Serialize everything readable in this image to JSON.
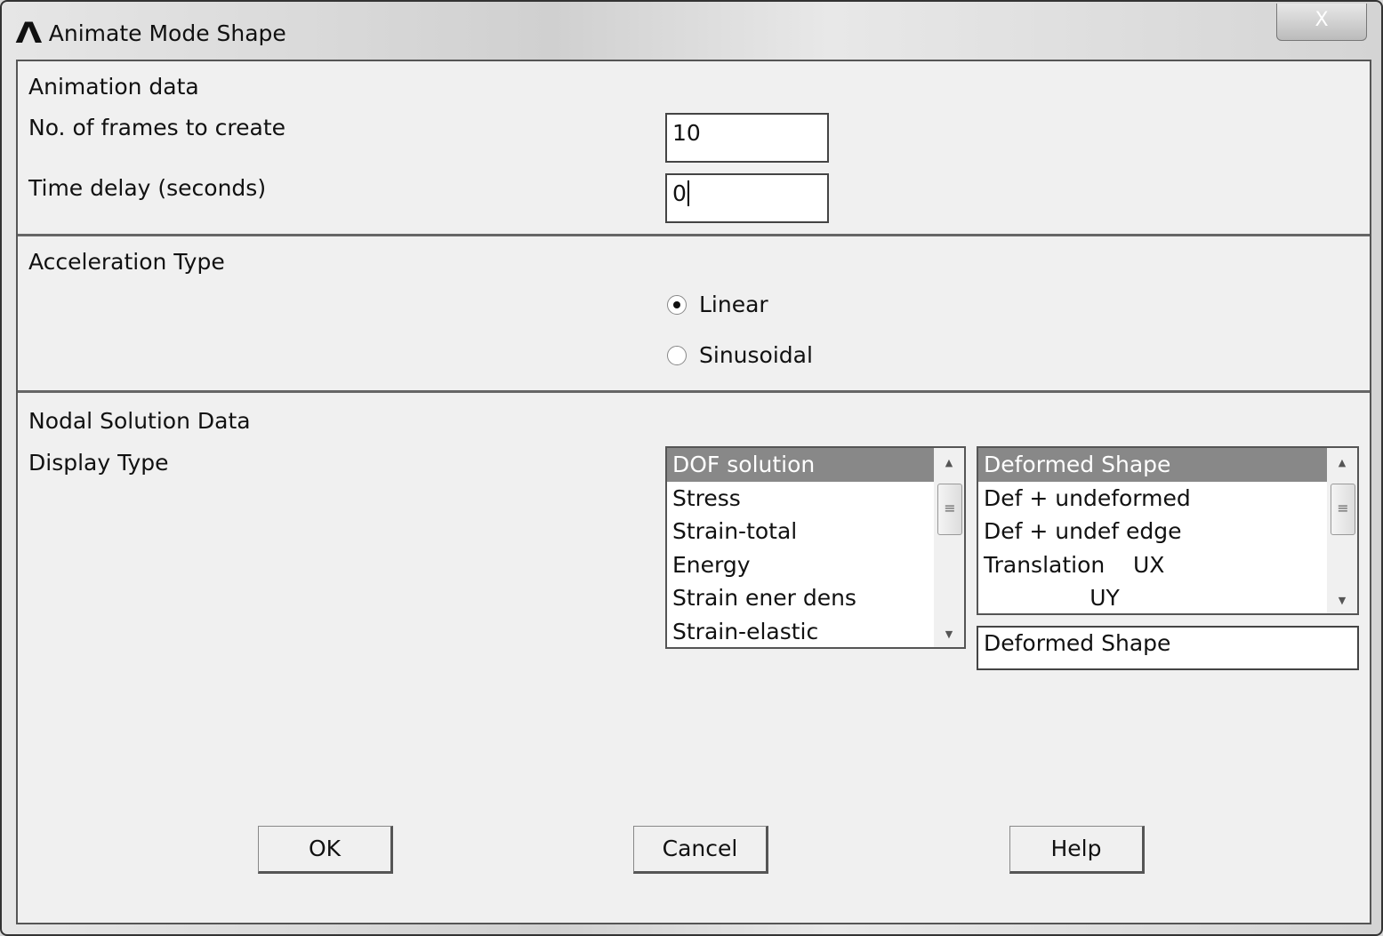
{
  "window": {
    "title": "Animate Mode Shape",
    "close": "X"
  },
  "animation": {
    "heading": "Animation data",
    "frames_label": "No. of frames to create",
    "frames_value": "10",
    "delay_label": "Time delay (seconds)",
    "delay_value": "0"
  },
  "acceleration": {
    "heading": "Acceleration Type",
    "options": [
      {
        "label": "Linear",
        "selected": true
      },
      {
        "label": "Sinusoidal",
        "selected": false
      }
    ]
  },
  "nodal": {
    "heading": "Nodal Solution Data",
    "display_label": "Display Type",
    "left_list": [
      "DOF solution",
      "Stress",
      "Strain-total",
      "Energy",
      "Strain ener dens",
      "Strain-elastic"
    ],
    "right_list": [
      "Deformed Shape",
      "Def + undeformed",
      "Def + undef edge",
      "Translation    UX",
      "               UY"
    ],
    "selection": "Deformed Shape"
  },
  "buttons": {
    "ok": "OK",
    "cancel": "Cancel",
    "help": "Help"
  }
}
